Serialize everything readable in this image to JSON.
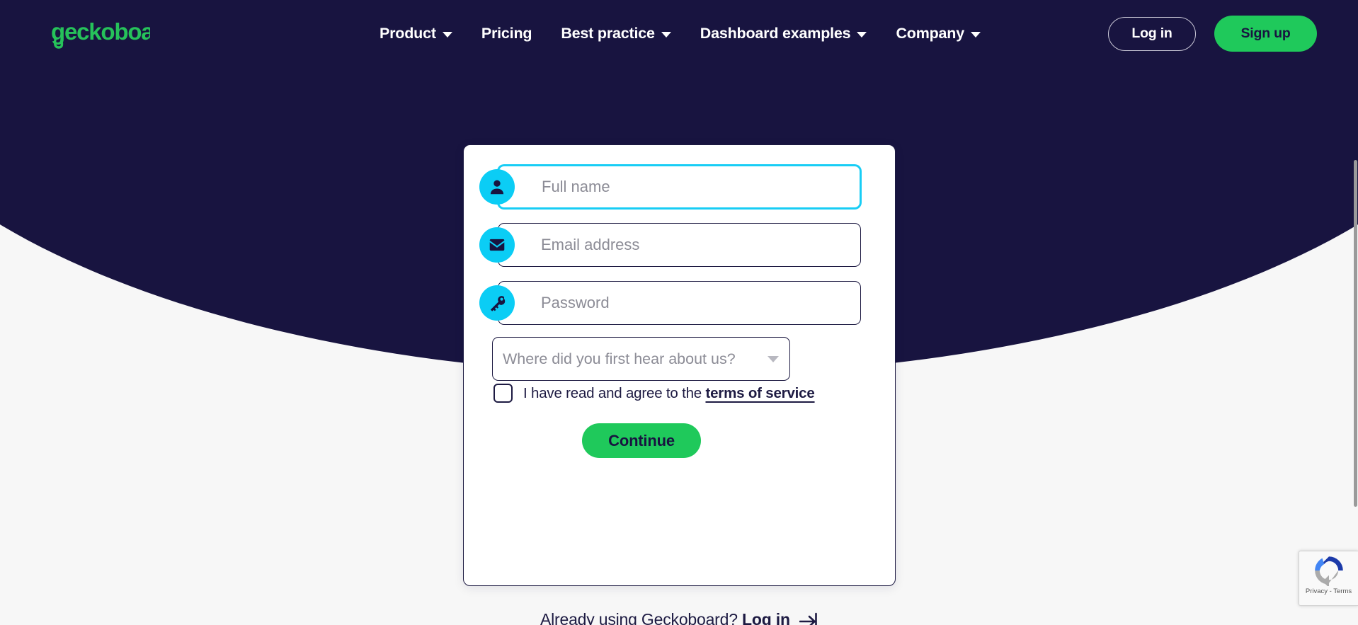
{
  "brand": {
    "logo_text": "geckoboard",
    "logo_color": "#26C25A",
    "hero_color": "#181440",
    "accent_cyan": "#0BCDF5",
    "accent_green": "#1FC95B",
    "page_background": "#F7F7F7"
  },
  "nav": {
    "links": [
      {
        "label": "Product",
        "has_dropdown": true
      },
      {
        "label": "Pricing",
        "has_dropdown": false
      },
      {
        "label": "Best practice",
        "has_dropdown": true
      },
      {
        "label": "Dashboard examples",
        "has_dropdown": true
      },
      {
        "label": "Company",
        "has_dropdown": true
      }
    ],
    "login_label": "Log in",
    "signup_label": "Sign up"
  },
  "signup_form": {
    "fields": [
      {
        "name": "full-name",
        "placeholder": "Full name",
        "value": "",
        "icon": "person-icon",
        "focused": true
      },
      {
        "name": "email",
        "placeholder": "Email address",
        "value": "",
        "icon": "envelope-icon",
        "focused": false
      },
      {
        "name": "password",
        "placeholder": "Password",
        "value": "",
        "icon": "key-icon",
        "focused": false
      }
    ],
    "referral_select": {
      "placeholder": "Where did you first hear about us?",
      "selected": "Where did you first hear about us?",
      "options": [
        "Where did you first hear about us?"
      ]
    },
    "terms": {
      "checked": false,
      "text": "I have read and agree to the",
      "link_label": "terms of service"
    },
    "submit_label": "Continue"
  },
  "login_prompt": {
    "text": "Already using Geckoboard?",
    "link_label": "Log in"
  },
  "recaptcha": {
    "label": "Privacy - Terms",
    "logo": "recaptcha-icon"
  }
}
